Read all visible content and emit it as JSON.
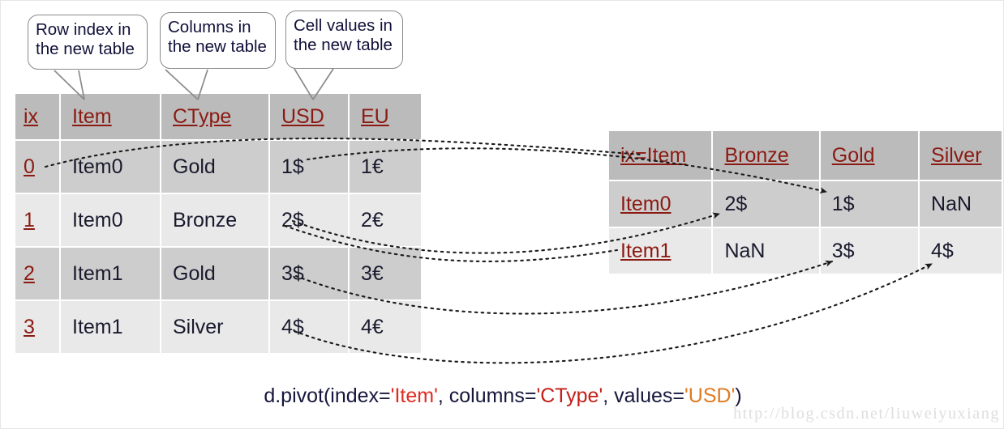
{
  "callouts": [
    {
      "text": "Row index in\nthe new table"
    },
    {
      "text": "Columns in\nthe new table"
    },
    {
      "text": "Cell values in\nthe new table"
    }
  ],
  "source_table": {
    "headers": [
      "ix",
      "Item",
      "CType",
      "USD",
      "EU"
    ],
    "rows": [
      {
        "ix": "0",
        "Item": "Item0",
        "CType": "Gold",
        "USD": "1$",
        "EU": "1€"
      },
      {
        "ix": "1",
        "Item": "Item0",
        "CType": "Bronze",
        "USD": "2$",
        "EU": "2€"
      },
      {
        "ix": "2",
        "Item": "Item1",
        "CType": "Gold",
        "USD": "3$",
        "EU": "3€"
      },
      {
        "ix": "3",
        "Item": "Item1",
        "CType": "Silver",
        "USD": "4$",
        "EU": "4€"
      }
    ]
  },
  "pivot_table": {
    "headers": [
      "ix=Item",
      "Bronze",
      "Gold",
      "Silver"
    ],
    "rows": [
      {
        "index": "Item0",
        "Bronze": "2$",
        "Gold": "1$",
        "Silver": "NaN"
      },
      {
        "index": "Item1",
        "Bronze": "NaN",
        "Gold": "3$",
        "Silver": "4$"
      }
    ]
  },
  "caption": {
    "prefix": "d.pivot(index=",
    "index_value": "'Item'",
    "mid1": ", columns=",
    "columns_value": "'CType'",
    "mid2": ", values=",
    "values_value": "'USD'",
    "suffix": ")"
  },
  "watermark": {
    "text": "http://blog.csdn.net/liuweiyuxiang"
  },
  "colors": {
    "header_bg": "#bbbbbb",
    "row_dark": "#cdcdcd",
    "row_light": "#e9e9e9",
    "header_text": "#8b1a12",
    "cell_text": "#1a1a2e",
    "arrow": "#1a1a1a",
    "callout_border": "#8a8a8a"
  }
}
